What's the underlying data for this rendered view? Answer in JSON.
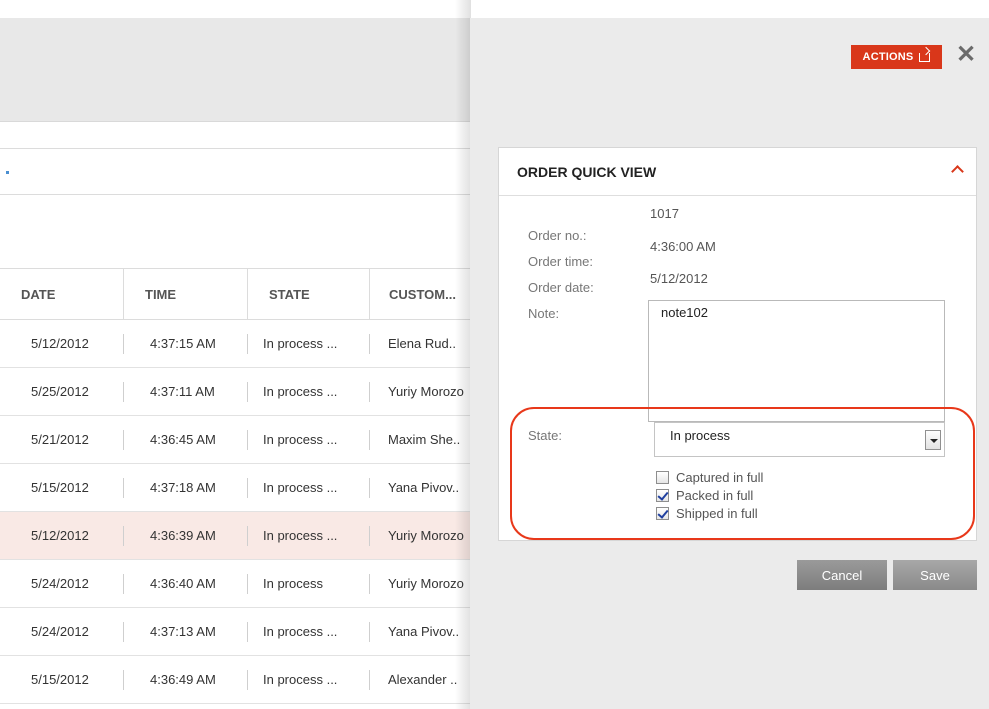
{
  "grid": {
    "columns": [
      "DATE",
      "TIME",
      "STATE",
      "CUSTOM..."
    ],
    "rows": [
      {
        "date": "5/12/2012",
        "time": "4:37:15 AM",
        "state": "In process ...",
        "customer": "Elena Rud.."
      },
      {
        "date": "5/25/2012",
        "time": "4:37:11 AM",
        "state": "In process ...",
        "customer": "Yuriy Morozo"
      },
      {
        "date": "5/21/2012",
        "time": "4:36:45 AM",
        "state": "In process ...",
        "customer": "Maxim She.."
      },
      {
        "date": "5/15/2012",
        "time": "4:37:18 AM",
        "state": "In process ...",
        "customer": "Yana Pivov.."
      },
      {
        "date": "5/12/2012",
        "time": "4:36:39 AM",
        "state": "In process ...",
        "customer": "Yuriy Morozo"
      },
      {
        "date": "5/24/2012",
        "time": "4:36:40 AM",
        "state": "In process",
        "customer": "Yuriy Morozo"
      },
      {
        "date": "5/24/2012",
        "time": "4:37:13 AM",
        "state": "In process ...",
        "customer": "Yana Pivov.."
      },
      {
        "date": "5/15/2012",
        "time": "4:36:49 AM",
        "state": "In process ...",
        "customer": "Alexander .."
      }
    ],
    "selected_row": 4
  },
  "panel": {
    "actions_label": "ACTIONS",
    "card_title": "ORDER QUICK VIEW",
    "fields": {
      "order_no_label": "Order no.:",
      "order_no": "1017",
      "order_time_label": "Order time:",
      "order_time": "4:36:00 AM",
      "order_date_label": "Order date:",
      "order_date": "5/12/2012",
      "note_label": "Note:",
      "note": "note102",
      "state_label": "State:",
      "state": "In process"
    },
    "checkboxes": [
      {
        "label": "Captured in full",
        "checked": false
      },
      {
        "label": "Packed in full",
        "checked": true
      },
      {
        "label": "Shipped in full",
        "checked": true
      }
    ],
    "cancel_label": "Cancel",
    "save_label": "Save"
  },
  "colors": {
    "accent": "#d9371a",
    "highlight": "#e8381a",
    "selected_row": "#f9e9e5"
  },
  "icons": [
    "actions-icon",
    "close-icon",
    "collapse-icon",
    "select-arrow-icon",
    "checkbox-icon"
  ]
}
